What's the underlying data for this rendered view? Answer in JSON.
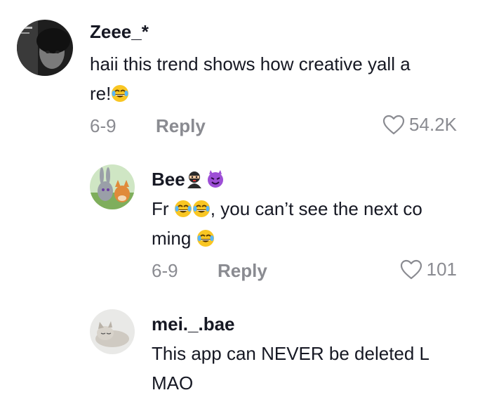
{
  "comments": [
    {
      "username": "Zeee_*",
      "text_line1": "haii this trend shows how creative yall a",
      "text_line2": "re!",
      "date": "6-9",
      "reply_label": "Reply",
      "likes": "54.2K",
      "icons": [
        "laughing-tears-emoji"
      ]
    },
    {
      "username": "Bee",
      "text_prefix": "Fr",
      "text_line1_rest": ", you can’t see the next co",
      "text_line2": "ming",
      "date": "6-9",
      "reply_label": "Reply",
      "likes": "101",
      "icons": [
        "ninja-emoji",
        "purple-devil-emoji",
        "laughing-tears-emoji"
      ]
    },
    {
      "username": "mei._.bae",
      "text_line1": "This app can NEVER be deleted L",
      "text_line2": "MAO"
    }
  ],
  "colors": {
    "text": "#161823",
    "muted": "#8a8b91",
    "background": "#ffffff"
  }
}
